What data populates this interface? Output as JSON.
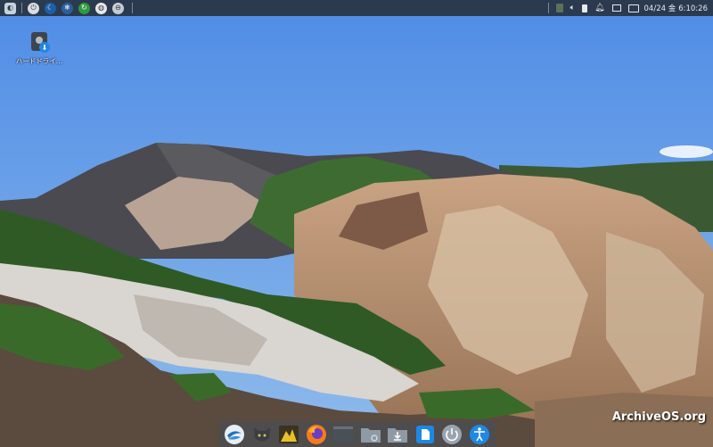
{
  "top_panel": {
    "launcher_icons": [
      "start-menu-icon",
      "power-icon",
      "moon-icon",
      "snowflake-icon",
      "refresh-icon",
      "overview-icon",
      "minimize-icon"
    ],
    "tray_icons": [
      "trash-icon",
      "volume-icon",
      "battery-icon",
      "notification-bell-icon",
      "display-icon",
      "keyboard-icon"
    ],
    "date": "04/24 金",
    "time": "6:10:26"
  },
  "desktop": {
    "icons": [
      {
        "label": "ハードドライ…",
        "icon": "hard-drive-icon"
      }
    ]
  },
  "dock": {
    "items": [
      "launcher-app",
      "cat-app",
      "photo-app",
      "firefox-browser",
      "terminal-app",
      "file-manager",
      "downloads-folder",
      "files-app",
      "power-button",
      "accessibility-button"
    ]
  },
  "watermark": "ArchiveOS.org"
}
